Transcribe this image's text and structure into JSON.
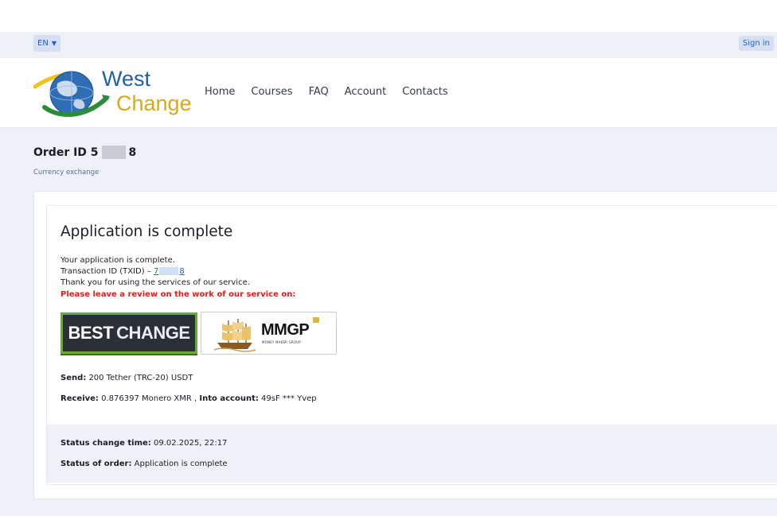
{
  "topbar": {
    "language": "EN",
    "sign_in": "Sign in"
  },
  "header": {
    "logo_line1": "West",
    "logo_line2": "Change",
    "nav": [
      "Home",
      "Courses",
      "FAQ",
      "Account",
      "Contacts"
    ]
  },
  "page": {
    "order_prefix": "Order ID 5",
    "order_suffix": "8",
    "breadcrumb": "Currency exchange"
  },
  "application": {
    "title": "Application is complete",
    "line1": "Your application is complete.",
    "txid_label": "Transaction ID (TXID) – ",
    "txid_prefix": "7",
    "txid_suffix": "8",
    "thanks": "Thank you for using the services of our service.",
    "review_prompt": "Please leave a review on the work of our service on:",
    "banners": {
      "bestchange_word1": "BEST",
      "bestchange_word2": "CHANGE",
      "mmgp_brand": "MMGP",
      "mmgp_tagline": "MONEY MAKER GROUP"
    }
  },
  "details": {
    "send_label": "Send:",
    "send_value": " 200 Tether (TRC-20) USDT",
    "receive_label": "Receive:",
    "receive_value": " 0.876397 Monero XMR , ",
    "account_label": "Into account:",
    "account_value": " 49sF *** Yvep"
  },
  "status": {
    "time_label": "Status change time:",
    "time_value": " 09.02.2025, 22:17",
    "order_label": "Status of order:",
    "order_value": " Application is complete"
  },
  "colors": {
    "accent": "#1c5fd4",
    "warning": "#e0211b",
    "panel_bg": "#eef2f8"
  }
}
